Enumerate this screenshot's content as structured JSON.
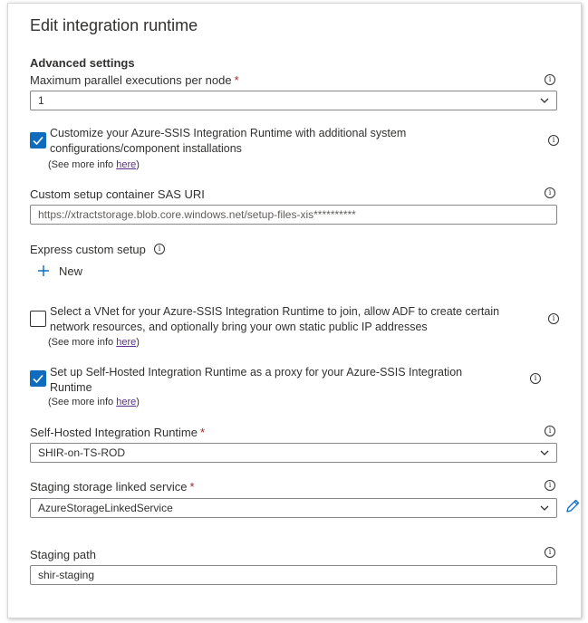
{
  "header": {
    "title": "Edit integration runtime"
  },
  "advanced": {
    "heading": "Advanced settings",
    "max_parallel": {
      "label": "Maximum parallel executions per node",
      "required_mark": "*",
      "value": "1"
    },
    "customize": {
      "checked": true,
      "line1": "Customize your Azure-SSIS Integration Runtime with additional system",
      "line2": "configurations/component installations",
      "more_prefix": "(See more info ",
      "more_link": "here",
      "more_suffix": ")"
    },
    "sas_uri": {
      "label": "Custom setup container SAS URI",
      "value": "https://xtractstorage.blob.core.windows.net/setup-files-xis**********"
    },
    "express": {
      "label": "Express custom setup",
      "new_label": "New"
    },
    "vnet": {
      "checked": false,
      "line1": "Select a VNet for your Azure-SSIS Integration Runtime to join, allow ADF to create certain",
      "line2": "network resources, and optionally bring your own static public IP addresses",
      "more_prefix": "(See more info ",
      "more_link": "here",
      "more_suffix": ")"
    },
    "proxy": {
      "checked": true,
      "line1": "Set up Self-Hosted Integration Runtime as a proxy for your Azure-SSIS Integration",
      "line2": "Runtime",
      "more_prefix": "(See more info ",
      "more_link": "here",
      "more_suffix": ")"
    },
    "shir": {
      "label": "Self-Hosted Integration Runtime",
      "required_mark": "*",
      "value": "SHIR-on-TS-ROD"
    },
    "staging_service": {
      "label": "Staging storage linked service",
      "required_mark": "*",
      "value": "AzureStorageLinkedService"
    },
    "staging_path": {
      "label": "Staging path",
      "value": "shir-staging"
    }
  },
  "colors": {
    "accent": "#0f6cbd",
    "required": "#a4262c",
    "link_visited": "#5c2d91"
  },
  "icons": [
    "info-icon",
    "chevron-down-icon",
    "checkmark-icon",
    "plus-icon",
    "pencil-icon"
  ]
}
